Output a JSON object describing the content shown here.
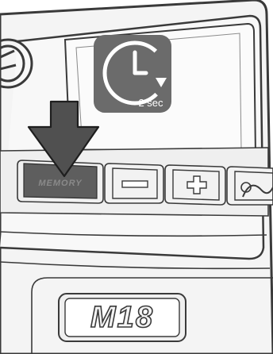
{
  "timer_badge": {
    "icon": "clock-icon",
    "label": "2 sec"
  },
  "arrow": {
    "icon": "down-arrow-icon"
  },
  "control_panel": {
    "buttons": [
      {
        "name": "memory-button",
        "label": "MEMORY",
        "state": "pressed"
      },
      {
        "name": "minus-button",
        "icon": "minus-icon"
      },
      {
        "name": "plus-button",
        "icon": "plus-icon"
      },
      {
        "name": "mode-button",
        "icon": "waveform-icon"
      }
    ]
  },
  "brand": {
    "logo_text": "M18"
  },
  "colors": {
    "badge_bg": "#6b6b6b",
    "memory_button": "#5e5e5e",
    "arrow": "#505050",
    "outline": "#3a3a3a"
  }
}
